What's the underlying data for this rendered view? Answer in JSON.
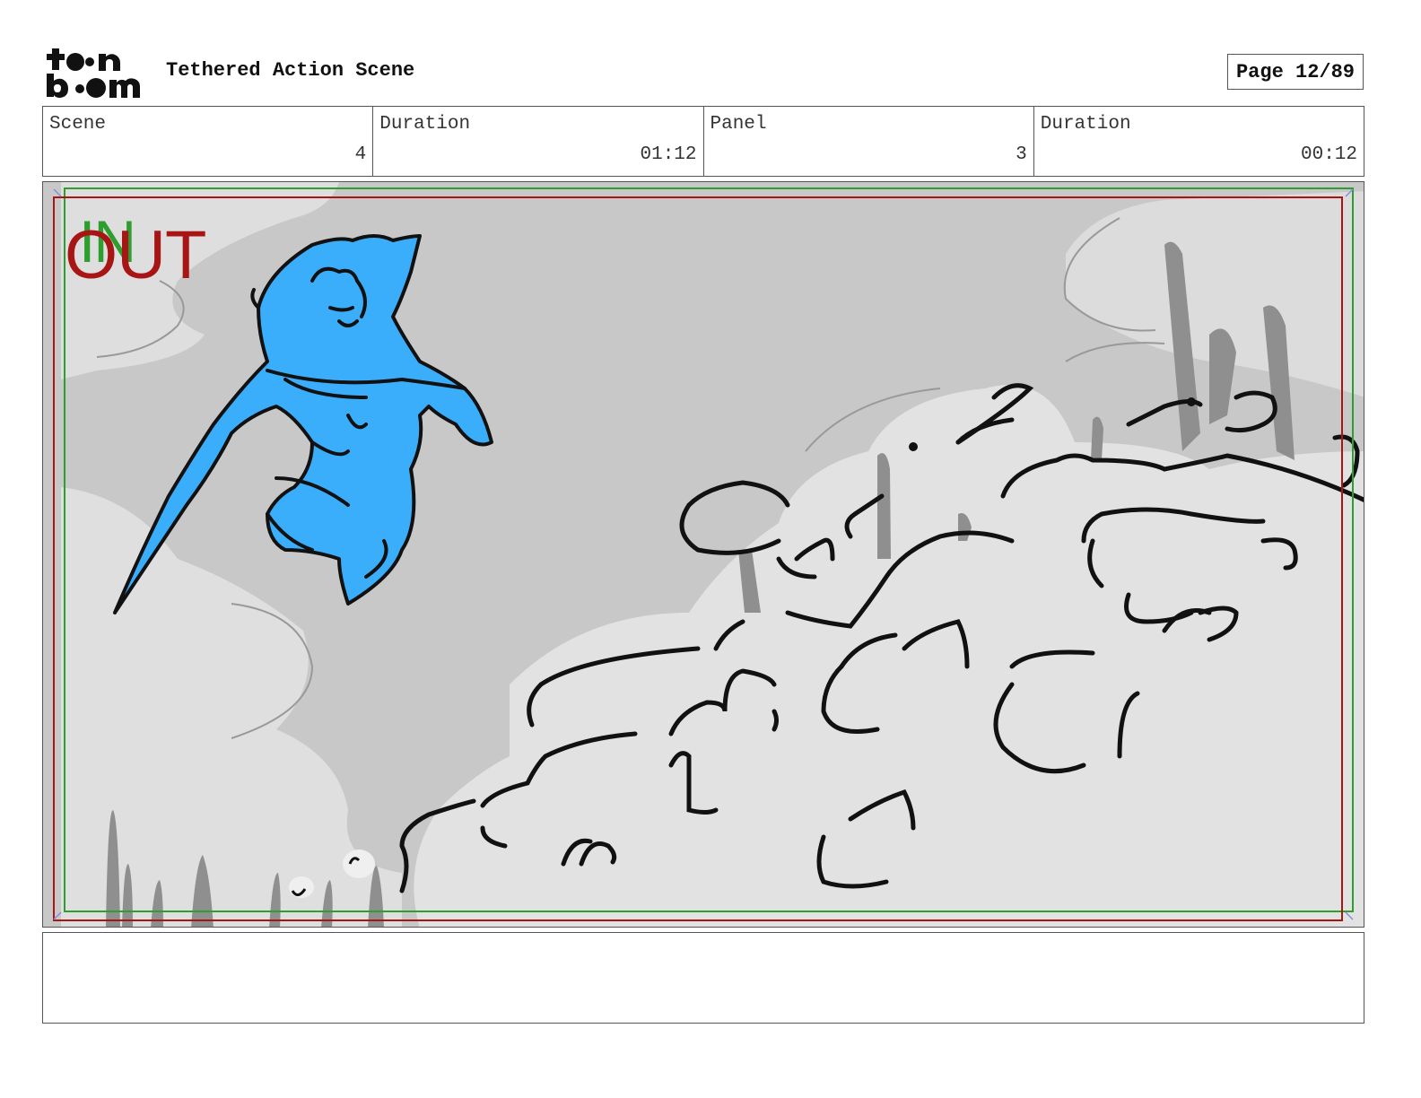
{
  "header": {
    "logo_text": "toon boom",
    "title": "Tethered Action Scene",
    "page_label": "Page 12/89"
  },
  "info": {
    "scene_label": "Scene",
    "scene_value": "4",
    "scene_duration_label": "Duration",
    "scene_duration_value": "01:12",
    "panel_label": "Panel",
    "panel_value": "3",
    "panel_duration_label": "Duration",
    "panel_duration_value": "00:12"
  },
  "panel": {
    "in_label": "IN",
    "out_label": "OUT",
    "colors": {
      "character_fill": "#3aaefb",
      "in_frame": "#2e9e2e",
      "out_frame": "#a81515",
      "sky": "#c9c9c9",
      "cloud": "#e3e3e3"
    }
  },
  "notes": {
    "text": ""
  }
}
